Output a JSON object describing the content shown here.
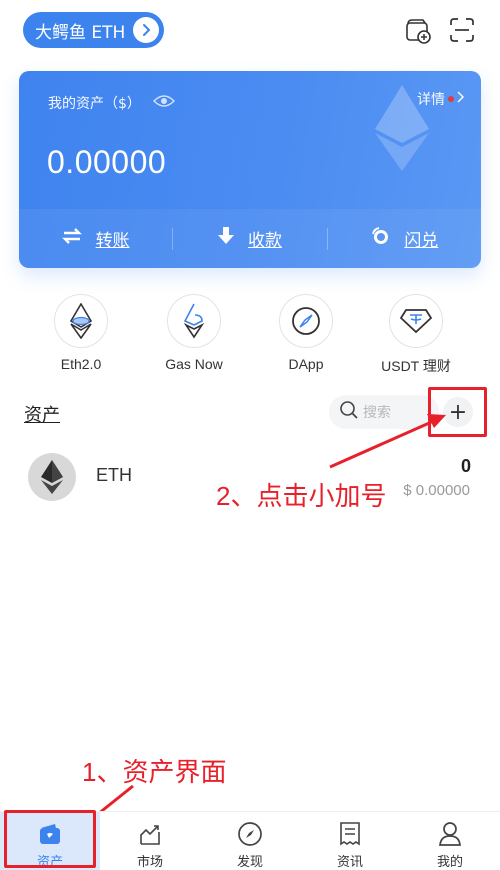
{
  "header": {
    "wallet_name": "大鳄鱼 ETH",
    "icons": [
      "wallet-add-icon",
      "scan-icon"
    ]
  },
  "card": {
    "label": "我的资产（$）",
    "amount": "0.00000",
    "detail_label": "详情",
    "actions": [
      {
        "label": "转账",
        "icon": "transfer-icon"
      },
      {
        "label": "收款",
        "icon": "receive-icon"
      },
      {
        "label": "闪兑",
        "icon": "swap-icon"
      }
    ]
  },
  "shortcuts": [
    {
      "label": "Eth2.0",
      "icon": "eth2-icon"
    },
    {
      "label": "Gas Now",
      "icon": "gas-icon"
    },
    {
      "label": "DApp",
      "icon": "compass-icon"
    },
    {
      "label": "USDT 理财",
      "icon": "usdt-icon"
    }
  ],
  "assets": {
    "title": "资产",
    "search_placeholder": "搜索",
    "add_label": "+",
    "items": [
      {
        "name": "ETH",
        "quantity": "0",
        "value": "$ 0.00000"
      }
    ]
  },
  "annotations": {
    "step1": "1、资产界面",
    "step2": "2、点击小加号"
  },
  "tabbar": {
    "active": 0,
    "tabs": [
      {
        "label": "资产",
        "icon": "wallet-icon"
      },
      {
        "label": "市场",
        "icon": "market-icon"
      },
      {
        "label": "发现",
        "icon": "discover-icon"
      },
      {
        "label": "资讯",
        "icon": "news-icon"
      },
      {
        "label": "我的",
        "icon": "profile-icon"
      }
    ]
  },
  "colors": {
    "accent": "#3d83ee",
    "annotation": "#e8202a"
  }
}
